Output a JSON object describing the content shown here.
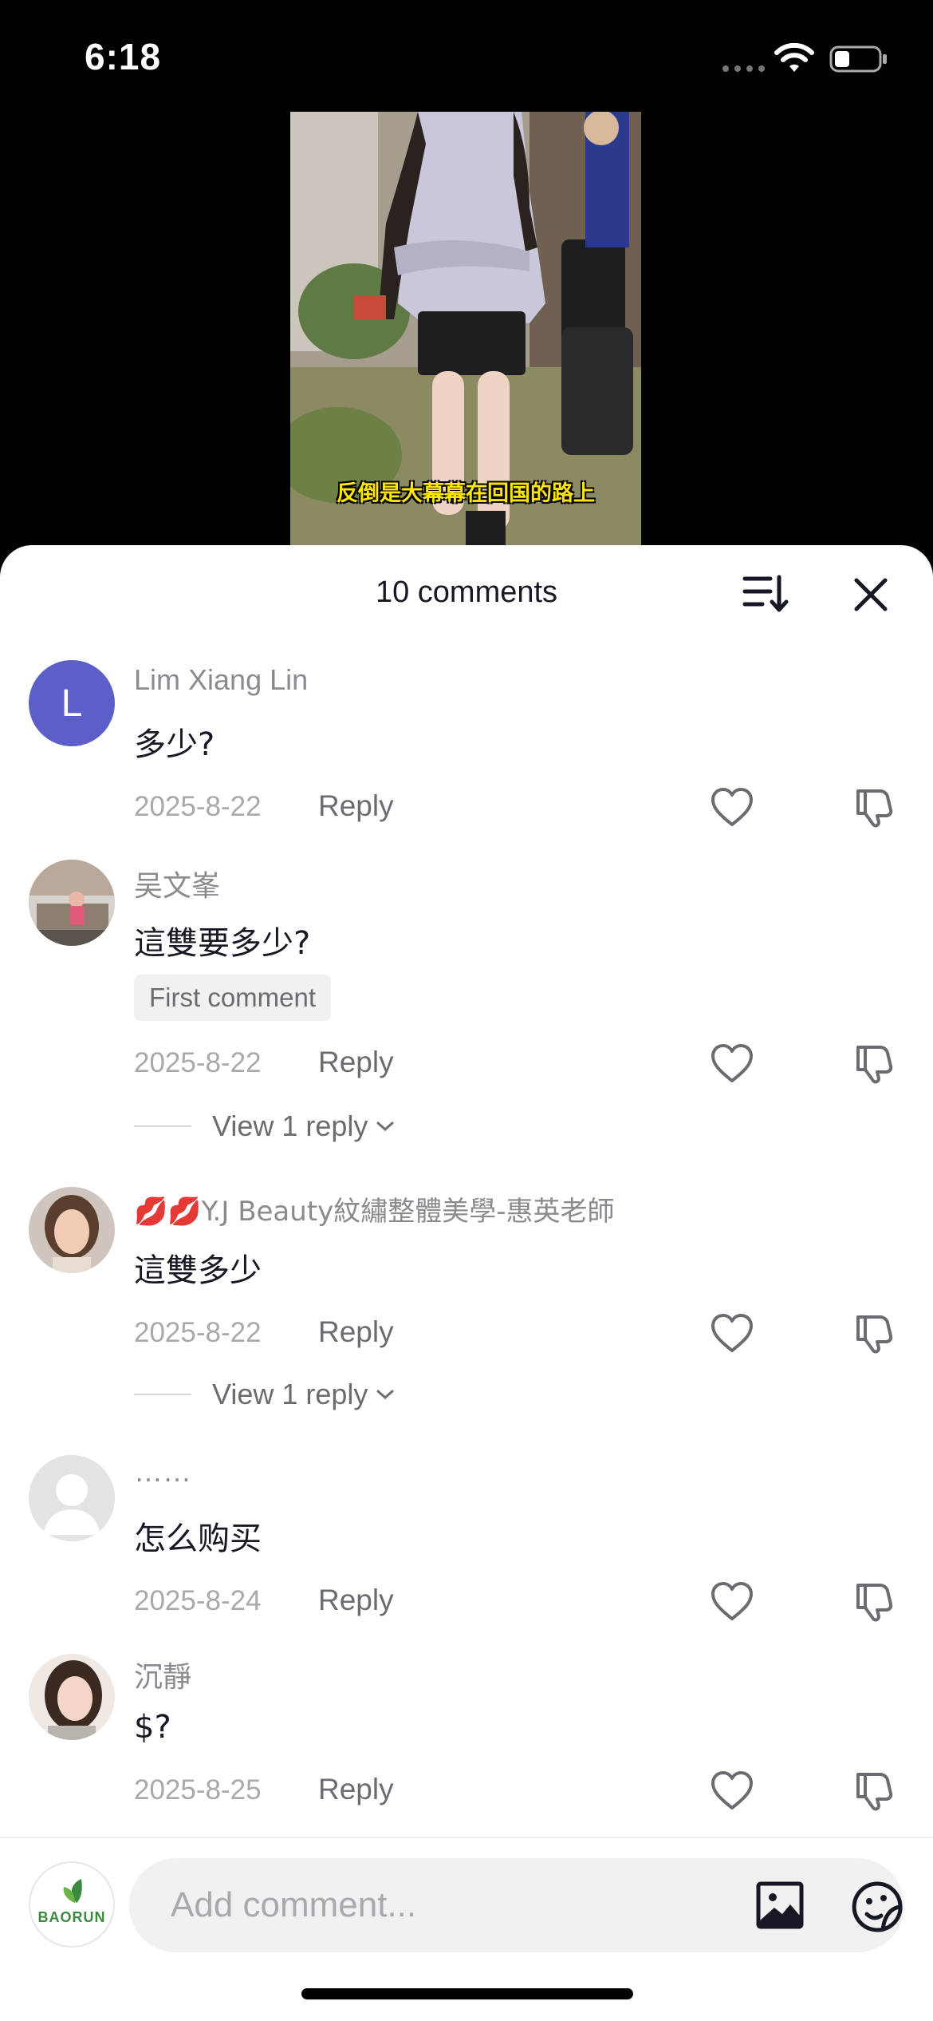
{
  "status_bar": {
    "time": "6:18"
  },
  "video": {
    "caption": "反倒是大幕幕在回国的路上"
  },
  "sheet": {
    "title": "10 comments",
    "reply_label": "Reply"
  },
  "comments": [
    {
      "avatar_letter": "L",
      "username": "Lim Xiang Lin",
      "text": "多少?",
      "date": "2025-8-22"
    },
    {
      "username": "吴文峯",
      "text": "這雙要多少?",
      "badge": "First comment",
      "date": "2025-8-22",
      "replies": "View 1 reply"
    },
    {
      "username": "💋💋Y.J Beauty紋繡整體美學-惠英老師",
      "text": "這雙多少",
      "date": "2025-8-22",
      "replies": "View 1 reply"
    },
    {
      "username": "……",
      "text": "怎么购买",
      "date": "2025-8-24"
    },
    {
      "username": "沉靜",
      "text": "$?",
      "date": "2025-8-25"
    }
  ],
  "composer": {
    "placeholder": "Add comment...",
    "brand": "BAORUN"
  },
  "colors": {
    "avatar_l": "#5b5fc7",
    "caption": "#ffe600"
  }
}
